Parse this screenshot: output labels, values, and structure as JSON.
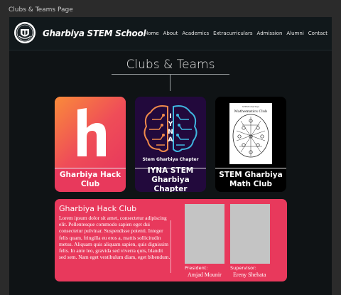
{
  "window": {
    "tab_label": "Clubs & Teams Page"
  },
  "navbar": {
    "brand": "Gharbiya STEM School",
    "links": [
      "Home",
      "About",
      "Academics",
      "Extracurriculars",
      "Admission",
      "Alumni",
      "Contact"
    ]
  },
  "page": {
    "title": "Clubs & Teams"
  },
  "clubs": [
    {
      "label": "Gharbiya Hack Club",
      "logo_letter": "h",
      "icon": "hack-club-logo-icon"
    },
    {
      "label": "IYNA STEM Gharbiya Chapter",
      "logo_text": "IYNA",
      "logo_subtext": "Stem Gharbiya Chapter",
      "icon": "iyna-brain-logo-icon"
    },
    {
      "label": "STEM Gharbiya Math Club",
      "logo_text": "Mathematics Club",
      "icon": "math-club-logo-icon"
    }
  ],
  "detail": {
    "title": "Gharbiya Hack Club",
    "description": "Lorem ipsum dolor sit amet, consectetur adipiscing elit. Pellentesque commodo sapien eget dui consectetur pulvinar. Suspendisse potenti. Integer felis quam, fringilla eu eros a, mattis sollicitudin metus. Aliquam quis aliquam sapien, quis dignissim felis. In ante leo, gravida sed viverra quis, blandit sed sem. Nam eget vestibulum diam, eget bibendum.",
    "president_role": "President:",
    "president_name": "Amjad Mounir",
    "supervisor_role": "Supervisor:",
    "supervisor_name": "Ereny Shehata"
  },
  "colors": {
    "accent": "#e8395c",
    "page_bg": "#0f1315",
    "navbar_bg": "#11181b",
    "iyna_bg": "#22093c"
  }
}
